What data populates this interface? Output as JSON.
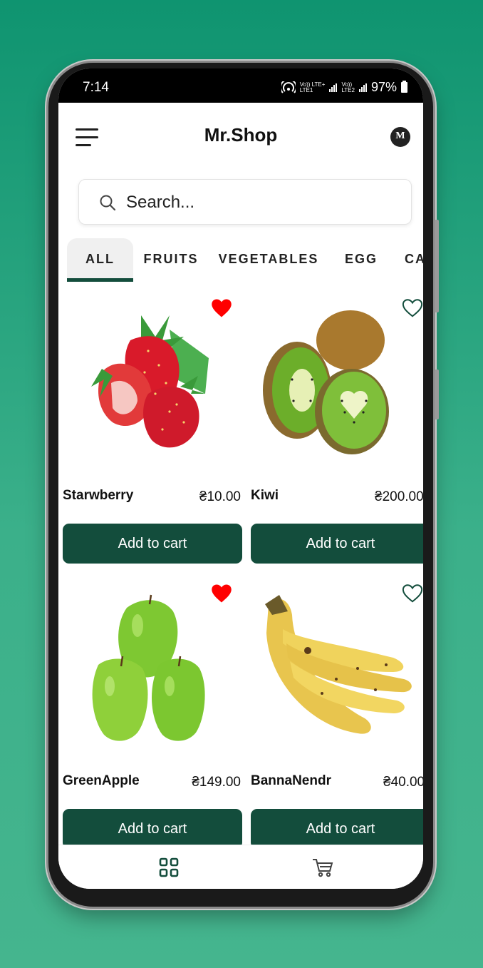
{
  "status_bar": {
    "time": "7:14",
    "net1": "Vo)) LTE+",
    "net1_sub": "LTE1",
    "net2": "Vo))",
    "net2_sub": "LTE2",
    "battery": "97%"
  },
  "header": {
    "title": "Mr.Shop",
    "logo_letter": "M",
    "menu_icon": "hamburger-menu-icon"
  },
  "search": {
    "placeholder": "Search..."
  },
  "tabs": [
    {
      "label": "ALL",
      "active": true
    },
    {
      "label": "FRUITS",
      "active": false
    },
    {
      "label": "VEGETABLES",
      "active": false
    },
    {
      "label": "EGG",
      "active": false
    },
    {
      "label": "CA",
      "active": false
    }
  ],
  "products": [
    {
      "name": "Starwberry",
      "price": "₴10.00",
      "favorite": true,
      "button": "Add to cart",
      "image": "strawberry"
    },
    {
      "name": "Kiwi",
      "price": "₴200.00",
      "favorite": false,
      "button": "Add to cart",
      "image": "kiwi"
    },
    {
      "name": "GreenApple",
      "price": "₴149.00",
      "favorite": true,
      "button": "Add to cart",
      "image": "green-apple"
    },
    {
      "name": "BannaNendr",
      "price": "₴40.00",
      "favorite": false,
      "button": "Add to cart",
      "image": "banana"
    }
  ],
  "bottom_nav": [
    {
      "icon": "grid-icon",
      "active": true
    },
    {
      "icon": "cart-icon",
      "active": false
    }
  ],
  "colors": {
    "background": "#1a9a74",
    "primary": "#134d3c",
    "favorite": "#ff0000"
  }
}
